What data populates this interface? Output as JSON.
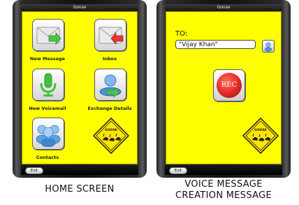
{
  "screens": [
    {
      "title": "Goose",
      "exit_label": "Exit",
      "tiles": [
        {
          "label": "New Message",
          "icon": "new-message-envelope-icon"
        },
        {
          "label": "Inbox",
          "icon": "inbox-envelope-icon"
        },
        {
          "label": "New Voicemail",
          "icon": "microphone-icon"
        },
        {
          "label": "Exchange Details",
          "icon": "exchange-person-icon"
        },
        {
          "label": "Contacts",
          "icon": "contacts-people-icon"
        }
      ],
      "logo_text": "GOOSE",
      "caption": "HOME SCREEN"
    },
    {
      "title": "Goose",
      "exit_label": "Exit",
      "to_label": "TO:",
      "recipient_value": "\"Vijay Khan\"",
      "rec_label": "REC",
      "logo_text": "GOOSE",
      "caption_line1": "VOICE MESSAGE",
      "caption_line2": "CREATION MESSAGE"
    }
  ],
  "colors": {
    "screen_background": "#ffff00",
    "rec_button": "#e02a24",
    "envelope_arrow_green": "#4cc24a",
    "envelope_arrow_red": "#e23b2e"
  }
}
